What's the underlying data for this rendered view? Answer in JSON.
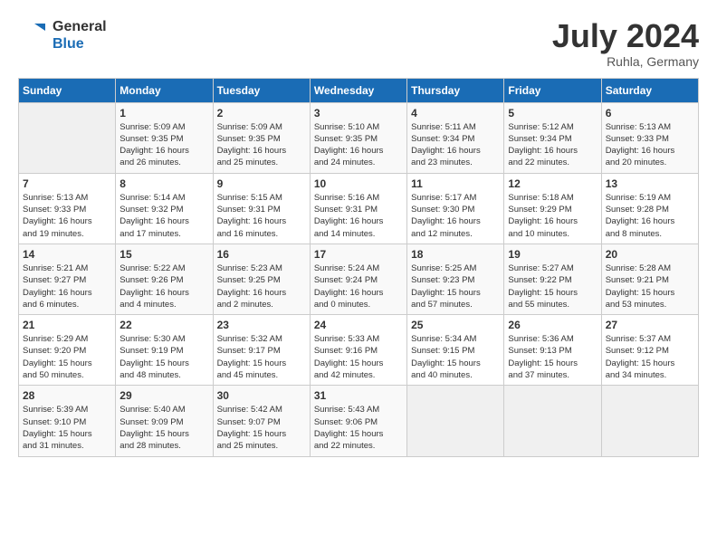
{
  "header": {
    "logo_line1": "General",
    "logo_line2": "Blue",
    "month": "July 2024",
    "location": "Ruhla, Germany"
  },
  "weekdays": [
    "Sunday",
    "Monday",
    "Tuesday",
    "Wednesday",
    "Thursday",
    "Friday",
    "Saturday"
  ],
  "weeks": [
    [
      {
        "day": "",
        "info": ""
      },
      {
        "day": "1",
        "info": "Sunrise: 5:09 AM\nSunset: 9:35 PM\nDaylight: 16 hours\nand 26 minutes."
      },
      {
        "day": "2",
        "info": "Sunrise: 5:09 AM\nSunset: 9:35 PM\nDaylight: 16 hours\nand 25 minutes."
      },
      {
        "day": "3",
        "info": "Sunrise: 5:10 AM\nSunset: 9:35 PM\nDaylight: 16 hours\nand 24 minutes."
      },
      {
        "day": "4",
        "info": "Sunrise: 5:11 AM\nSunset: 9:34 PM\nDaylight: 16 hours\nand 23 minutes."
      },
      {
        "day": "5",
        "info": "Sunrise: 5:12 AM\nSunset: 9:34 PM\nDaylight: 16 hours\nand 22 minutes."
      },
      {
        "day": "6",
        "info": "Sunrise: 5:13 AM\nSunset: 9:33 PM\nDaylight: 16 hours\nand 20 minutes."
      }
    ],
    [
      {
        "day": "7",
        "info": "Sunrise: 5:13 AM\nSunset: 9:33 PM\nDaylight: 16 hours\nand 19 minutes."
      },
      {
        "day": "8",
        "info": "Sunrise: 5:14 AM\nSunset: 9:32 PM\nDaylight: 16 hours\nand 17 minutes."
      },
      {
        "day": "9",
        "info": "Sunrise: 5:15 AM\nSunset: 9:31 PM\nDaylight: 16 hours\nand 16 minutes."
      },
      {
        "day": "10",
        "info": "Sunrise: 5:16 AM\nSunset: 9:31 PM\nDaylight: 16 hours\nand 14 minutes."
      },
      {
        "day": "11",
        "info": "Sunrise: 5:17 AM\nSunset: 9:30 PM\nDaylight: 16 hours\nand 12 minutes."
      },
      {
        "day": "12",
        "info": "Sunrise: 5:18 AM\nSunset: 9:29 PM\nDaylight: 16 hours\nand 10 minutes."
      },
      {
        "day": "13",
        "info": "Sunrise: 5:19 AM\nSunset: 9:28 PM\nDaylight: 16 hours\nand 8 minutes."
      }
    ],
    [
      {
        "day": "14",
        "info": "Sunrise: 5:21 AM\nSunset: 9:27 PM\nDaylight: 16 hours\nand 6 minutes."
      },
      {
        "day": "15",
        "info": "Sunrise: 5:22 AM\nSunset: 9:26 PM\nDaylight: 16 hours\nand 4 minutes."
      },
      {
        "day": "16",
        "info": "Sunrise: 5:23 AM\nSunset: 9:25 PM\nDaylight: 16 hours\nand 2 minutes."
      },
      {
        "day": "17",
        "info": "Sunrise: 5:24 AM\nSunset: 9:24 PM\nDaylight: 16 hours\nand 0 minutes."
      },
      {
        "day": "18",
        "info": "Sunrise: 5:25 AM\nSunset: 9:23 PM\nDaylight: 15 hours\nand 57 minutes."
      },
      {
        "day": "19",
        "info": "Sunrise: 5:27 AM\nSunset: 9:22 PM\nDaylight: 15 hours\nand 55 minutes."
      },
      {
        "day": "20",
        "info": "Sunrise: 5:28 AM\nSunset: 9:21 PM\nDaylight: 15 hours\nand 53 minutes."
      }
    ],
    [
      {
        "day": "21",
        "info": "Sunrise: 5:29 AM\nSunset: 9:20 PM\nDaylight: 15 hours\nand 50 minutes."
      },
      {
        "day": "22",
        "info": "Sunrise: 5:30 AM\nSunset: 9:19 PM\nDaylight: 15 hours\nand 48 minutes."
      },
      {
        "day": "23",
        "info": "Sunrise: 5:32 AM\nSunset: 9:17 PM\nDaylight: 15 hours\nand 45 minutes."
      },
      {
        "day": "24",
        "info": "Sunrise: 5:33 AM\nSunset: 9:16 PM\nDaylight: 15 hours\nand 42 minutes."
      },
      {
        "day": "25",
        "info": "Sunrise: 5:34 AM\nSunset: 9:15 PM\nDaylight: 15 hours\nand 40 minutes."
      },
      {
        "day": "26",
        "info": "Sunrise: 5:36 AM\nSunset: 9:13 PM\nDaylight: 15 hours\nand 37 minutes."
      },
      {
        "day": "27",
        "info": "Sunrise: 5:37 AM\nSunset: 9:12 PM\nDaylight: 15 hours\nand 34 minutes."
      }
    ],
    [
      {
        "day": "28",
        "info": "Sunrise: 5:39 AM\nSunset: 9:10 PM\nDaylight: 15 hours\nand 31 minutes."
      },
      {
        "day": "29",
        "info": "Sunrise: 5:40 AM\nSunset: 9:09 PM\nDaylight: 15 hours\nand 28 minutes."
      },
      {
        "day": "30",
        "info": "Sunrise: 5:42 AM\nSunset: 9:07 PM\nDaylight: 15 hours\nand 25 minutes."
      },
      {
        "day": "31",
        "info": "Sunrise: 5:43 AM\nSunset: 9:06 PM\nDaylight: 15 hours\nand 22 minutes."
      },
      {
        "day": "",
        "info": ""
      },
      {
        "day": "",
        "info": ""
      },
      {
        "day": "",
        "info": ""
      }
    ]
  ]
}
